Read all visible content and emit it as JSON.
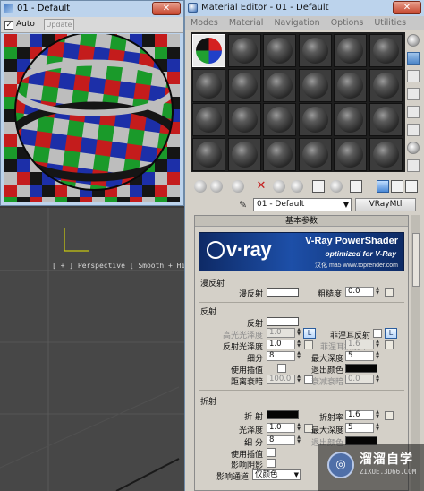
{
  "render_window": {
    "title": "01 - Default",
    "close_label": "✕",
    "auto_label": "Auto",
    "auto_checked_mark": "✓",
    "update_label": "Update"
  },
  "viewport": {
    "label": "[ + ] Perspective [ Smooth + Highl"
  },
  "material_editor": {
    "title": "Material Editor - 01 - Default",
    "close_label": "✕",
    "menu": [
      "Modes",
      "Material",
      "Navigation",
      "Options",
      "Utilities"
    ],
    "material_name": "01 - Default",
    "material_type": "VRayMtl",
    "rollout_title": "基本参数",
    "banner": {
      "logo": "v·ray",
      "product": "V-Ray PowerShader",
      "optimized": "optimized for V-Ray",
      "credit": "汉化 ma5 www.toprender.com"
    },
    "diffuse_section": {
      "title": "漫反射",
      "diffuse_label": "漫反射",
      "roughness_label": "粗糙度",
      "roughness_value": "0.0"
    },
    "reflection_section": {
      "title": "反射",
      "reflect_label": "反射",
      "hilight_gloss_label": "高光光泽度",
      "hilight_gloss_value": "1.0",
      "lock_label": "L",
      "fresnel_label": "菲涅耳反射",
      "refl_gloss_label": "反射光泽度",
      "refl_gloss_value": "1.0",
      "fresnel_ior_label": "菲涅耳折射率",
      "fresnel_ior_value": "1.6",
      "subdivs_label": "细分",
      "subdivs_value": "8",
      "max_depth_label": "最大深度",
      "max_depth_value": "5",
      "use_interp_label": "使用插值",
      "exit_color_label": "退出颜色",
      "dim_distance_label": "距离衰暗",
      "dim_distance_value": "100.0",
      "dim_falloff_label": "衰减衰暗",
      "dim_falloff_value": "0.0"
    },
    "refraction_section": {
      "title": "折射",
      "refract_label": "折 射",
      "ior_label": "折射率",
      "ior_value": "1.6",
      "glossiness_label": "光泽度",
      "glossiness_value": "1.0",
      "max_depth_label": "最大深度",
      "max_depth_value": "5",
      "subdivs_label": "细 分",
      "subdivs_value": "8",
      "exit_color_label": "退出颜色",
      "use_interp_label": "使用插值",
      "affect_shadows_label": "影响阴影",
      "affect_channels_label": "影响通道",
      "affect_channels_value": "仅颜色"
    }
  },
  "watermark": {
    "logo": "◎",
    "title": "溜溜自学",
    "subtitle": "ZIXUE.3D66.COM"
  }
}
